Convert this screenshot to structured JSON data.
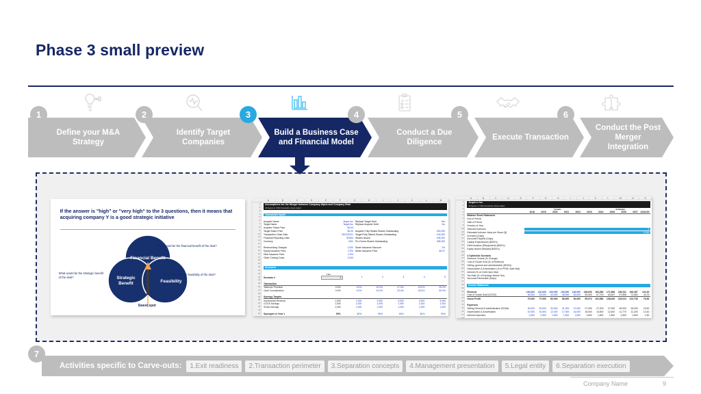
{
  "slide": {
    "title": "Phase 3 small preview"
  },
  "process": {
    "steps": [
      {
        "num": "1",
        "label": "Define your M&A Strategy",
        "icon": "lightbulb-icon",
        "active": false
      },
      {
        "num": "2",
        "label": "Identify Target Companies",
        "icon": "magnifier-pulse-icon",
        "active": false
      },
      {
        "num": "3",
        "label": "Build a Business Case and Financial Model",
        "icon": "bar-chart-icon",
        "active": true
      },
      {
        "num": "4",
        "label": "Conduct a Due Diligence",
        "icon": "clipboard-checklist-icon",
        "active": false
      },
      {
        "num": "5",
        "label": "Execute Transaction",
        "icon": "handshake-icon",
        "active": false
      },
      {
        "num": "6",
        "label": "Conduct the Post Merger Integration",
        "icon": "puzzle-icon",
        "active": false
      }
    ],
    "active_color": "#152764",
    "inactive_color": "#bdbdbd",
    "active_badge_color": "#29a9e0"
  },
  "preview": {
    "card1": {
      "heading": "If the answer is \"high\" or \"very high\" to the 3 questions, then it means that acquiring company Y is a good strategic initiative",
      "venn": {
        "circles": [
          "Financial Benefit",
          "Strategic Benefit",
          "Feasibility"
        ],
        "center_label": "Sweet spot",
        "questions": [
          "What would be the financial benefit of the deal?",
          "What would be the strategic benefit of the deal?",
          "What would be the feasibility of the deal?"
        ]
      }
    },
    "card2": {
      "title": "Assumptions for the Merger between Company Alpha and Company Beta",
      "subtitle": "All figures in USD thousands unless stated",
      "section1": "Transaction Inputs",
      "columns": [
        "A",
        "B",
        "C",
        "D",
        "E",
        "F",
        "G",
        "H",
        "I",
        "J",
        "K",
        "L",
        "M"
      ],
      "inputs_left": [
        {
          "label": "Acquirer Name",
          "value": "Buyer Inc"
        },
        {
          "label": "Target Name",
          "value": "Target Inc"
        },
        {
          "label": "Acquirer Share Price",
          "value": "$3.00"
        },
        {
          "label": "Target Share Price",
          "value": "$2.00"
        },
        {
          "label": "Transaction Close Date",
          "value": "30/12/2021"
        },
        {
          "label": "Financial Reporting Units",
          "value": "$'000s"
        },
        {
          "label": "Currency",
          "value": "USD"
        },
        {
          "label": "Restructuring Charges",
          "value": "1,000"
        },
        {
          "label": "Equity Issuance Fees",
          "value": "2.5%"
        },
        {
          "label": "Debt Issuance Fees",
          "value": "2.5%"
        },
        {
          "label": "Other Closing Costs",
          "value": "1,000"
        }
      ],
      "inputs_right": [
        {
          "label": "Replace Target Debt",
          "value": "Yes"
        },
        {
          "label": "Replace Acquirer Debt",
          "value": "No"
        },
        {
          "label": "Acquirer Fully Diluted Shares Outstanding",
          "value": "200,000"
        },
        {
          "label": "Target Fully Diluted Shares Outstanding",
          "value": "100,000"
        },
        {
          "label": "Shares Issued",
          "value": "108,300"
        },
        {
          "label": "Pro Forma Shares Outstanding",
          "value": "308,300"
        },
        {
          "label": "Share Issuance Discount",
          "value": "1%"
        },
        {
          "label": "Share Issuance Price",
          "value": "$2.97"
        }
      ],
      "section2": "Scenarios",
      "scenario_header": "Live",
      "scenario_row": {
        "label": "Scenario #",
        "selected": "3",
        "options": [
          "1",
          "2",
          "3",
          "4",
          "5"
        ]
      },
      "groups": [
        {
          "name": "Transaction",
          "rows": [
            {
              "label": "Takeover Premium",
              "cells": [
                "0.0%",
                "0.0%",
                "10.0%",
                "17.0%",
                "20.0%",
                "25.0%"
              ]
            },
            {
              "label": "Cash Consideration",
              "cells": [
                "0.0%",
                "0.0%",
                "10.0%",
                "20.0%",
                "30.0%",
                "50.0%"
              ]
            }
          ]
        },
        {
          "name": "Synergy Targets",
          "rows": [
            {
              "label": "Incremental Revenue",
              "cells": [
                "1,000",
                "1,000",
                "2,000",
                "3,000",
                "4,000",
                "5,000"
              ]
            },
            {
              "label": "COGS Savings",
              "cells": [
                "1,000",
                "1,000",
                "1,000",
                "1,000",
                "1,000",
                "1,000"
              ]
            },
            {
              "label": "SG&A Savings",
              "cells": [
                "1,000",
                "1,000",
                "1,000",
                "1,000",
                "1,000",
                "1,000"
              ]
            }
          ]
        }
      ],
      "footer_row": {
        "label": "Synergies in Year 1",
        "cells": [
          "50%",
          "50%",
          "50%",
          "50%",
          "50%",
          "50%"
        ]
      }
    },
    "card3": {
      "title": "Acquirer Inc",
      "subtitle": "All figures in USD thousands unless stated",
      "group_labels": [
        "Actuals",
        "Estimates"
      ],
      "years": [
        "2018",
        "2019",
        "2020",
        "2021",
        "2022",
        "2023",
        "2024",
        "2025",
        "2026",
        "2027",
        "12/31/20"
      ],
      "header_rows": [
        "Balance Sheet Statement",
        "End of Period",
        "Start of Period",
        "Fraction of Year",
        "Selected Scenario",
        "Estimated Intrinsic Value per Share ($)"
      ],
      "selected_scenario": "3",
      "intrinsic_value": "13.46",
      "mid_rows": [
        "Inventory (Days)",
        "Accounts Payable (Days)",
        "Capital Expenditures ($000's)",
        "Debt Issuance (Repayment) ($000's)",
        "Equity Issued (Repaid) ($000's)"
      ],
      "scenario_section": "3 Optimistic Scenario",
      "scenario_rows": [
        "Revenue Growth (% Change)",
        "Cost of Goods Sold (% of Revenue)",
        "Selling, general and administrative ($000's)",
        "Depreciation & Amortisation (% of PP&E Open Bal)",
        "Interest (% on Debt Open Bal)",
        "Tax Rate (% of Earnings Before Tax)",
        "Accounts Receivable (Days)"
      ],
      "income_section": "Income Statement",
      "income_rows": [
        {
          "label": "Revenue",
          "cells": [
            "100,000",
            "110,000",
            "120,000",
            "130,000",
            "140,000",
            "148,000",
            "160,280",
            "171,508",
            "182,911",
            "196,287",
            "124,20"
          ]
        },
        {
          "label": "Cost of Goods Sold (COGS)",
          "cells": [
            "30,000",
            "33,000",
            "40,000",
            "45,000",
            "50,000",
            "53,000",
            "57,700",
            "63,457",
            "67,898",
            "72,652",
            "44,76"
          ]
        },
        {
          "label": "Gross Profit",
          "cells": [
            "70,000",
            "77,000",
            "80,000",
            "85,000",
            "90,000",
            "95,072",
            "102,580",
            "108,049",
            "115,013",
            "123,735",
            "79,50"
          ]
        }
      ],
      "expense_section": "Expenses",
      "expense_rows": [
        {
          "label": "Selling General & Administrative (SG&A)",
          "cells": [
            "30,000",
            "29,000",
            "30,000",
            "31,000",
            "37,000",
            "27,000",
            "27,000",
            "27,000",
            "28,000",
            "28,000",
            "23,40"
          ]
        },
        {
          "label": "Depreciation & Amortisation",
          "cells": [
            "10,000",
            "10,500",
            "12,000",
            "17,000",
            "16,000",
            "15,000",
            "13,500",
            "12,400",
            "11,770",
            "11,200",
            "12,40"
          ]
        },
        {
          "label": "Interest expenses",
          "cells": [
            "2,500",
            "2,500",
            "1,500",
            "1,500",
            "1,500",
            "1,500",
            "1,500",
            "1,500",
            "1,500",
            "1,500",
            "1,50"
          ]
        }
      ]
    }
  },
  "carveouts": {
    "badge": "7",
    "title": "Activities specific to Carve-outs:",
    "chips": [
      "1.Exit readiness",
      "2.Transaction perimeter",
      "3.Separation concepts",
      "4.Management presentation",
      "5.Legal entity",
      "6.Separation execution"
    ]
  },
  "footer": {
    "company": "Company Name",
    "page": "9"
  }
}
